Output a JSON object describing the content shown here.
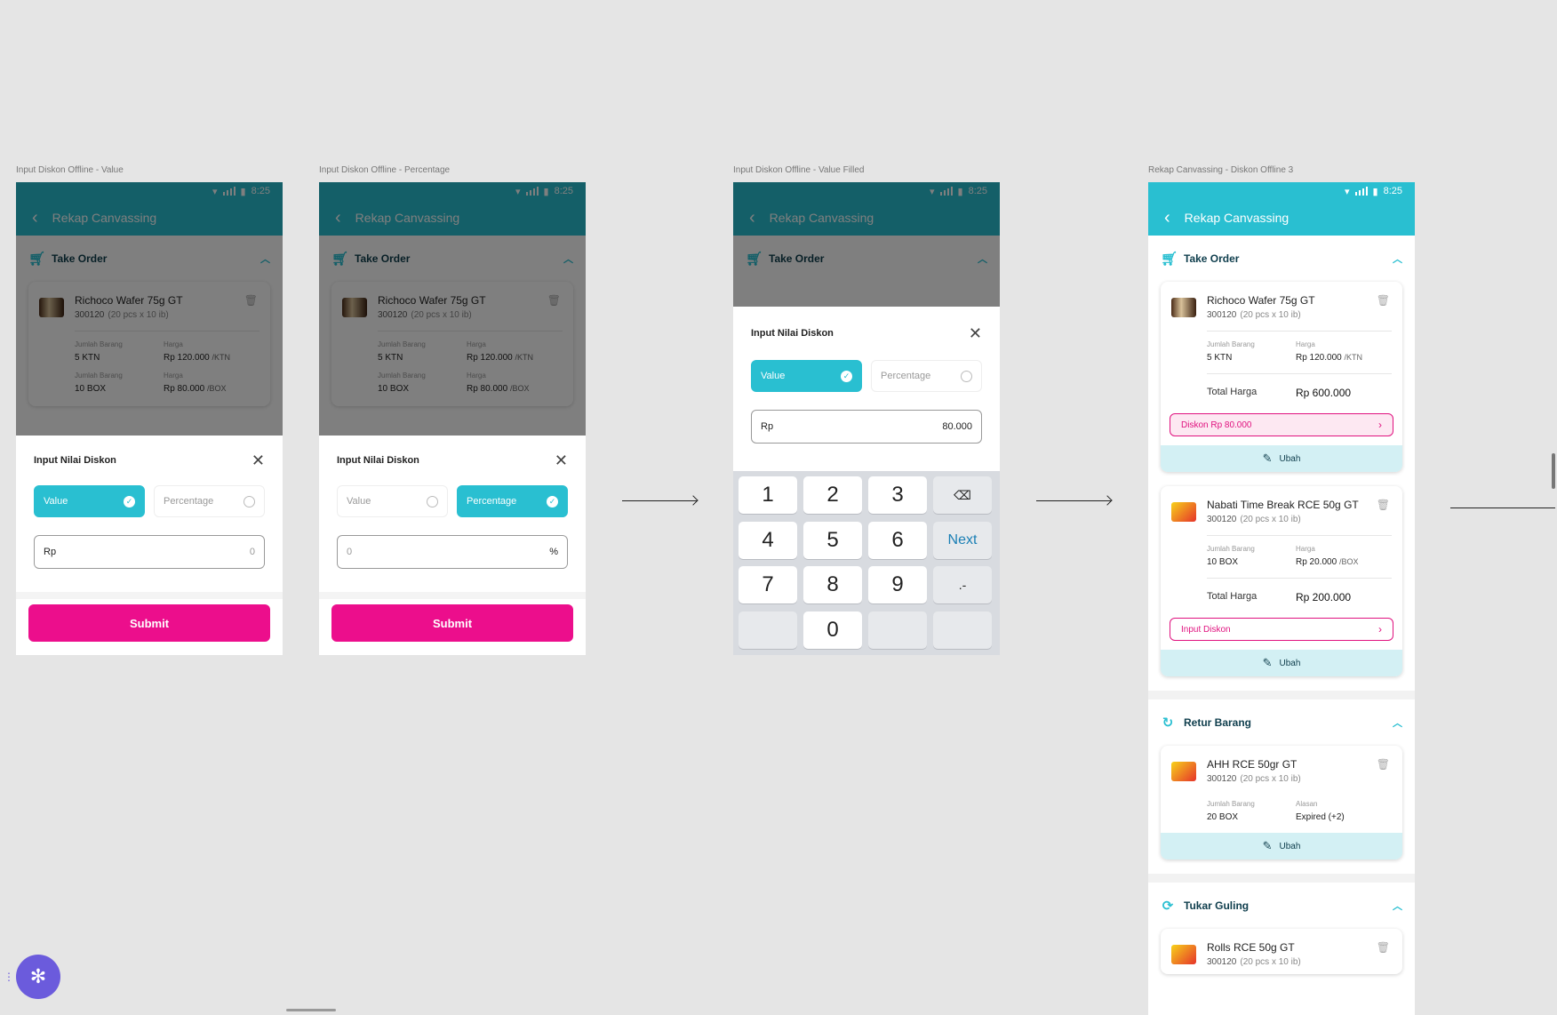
{
  "frames": {
    "f1": {
      "label": "Input Diskon Offline - Value"
    },
    "f2": {
      "label": "Input Diskon Offline - Percentage"
    },
    "f3": {
      "label": "Input Diskon Offline - Value Filled"
    },
    "f4": {
      "label": "Rekap Canvassing - Diskon Offline 3"
    }
  },
  "status": {
    "time": "8:25"
  },
  "appbar": {
    "title": "Rekap Canvassing",
    "back_icon": "arrow-left-icon"
  },
  "sections": {
    "take_order": "Take Order",
    "retur": "Retur Barang",
    "tukar": "Tukar Guling"
  },
  "products": {
    "p1": {
      "name": "Richoco Wafer 75g GT",
      "code": "300120",
      "pack": "(20 pcs x 10 ib)",
      "qty_label": "Jumlah Barang",
      "qty1": "5 KTN",
      "qty2": "10 BOX",
      "price_label": "Harga",
      "price1": "Rp 120.000",
      "unit1": "/KTN",
      "price2": "Rp 80.000",
      "unit2": "/BOX",
      "total_label": "Total Harga",
      "total": "Rp 600.000",
      "discount": "Diskon Rp 80.000"
    },
    "p2": {
      "name": "Nabati Time Break RCE 50g GT",
      "code": "300120",
      "pack": "(20 pcs x 10 ib)",
      "qty_label": "Jumlah Barang",
      "qty1": "10 BOX",
      "price_label": "Harga",
      "price1": "Rp 20.000",
      "unit1": "/BOX",
      "total_label": "Total Harga",
      "total": "Rp 200.000",
      "discount": "Input Diskon"
    },
    "p3": {
      "name": "AHH RCE 50gr GT",
      "code": "300120",
      "pack": "(20 pcs x 10 ib)",
      "qty_label": "Jumlah Barang",
      "qty1": "20 BOX",
      "reason_label": "Alasan",
      "reason": "Expired (+2)"
    },
    "p4": {
      "name": "Rolls RCE 50g GT",
      "code": "300120",
      "pack": "(20 pcs x 10 ib)"
    }
  },
  "ubah_label": "Ubah",
  "sheet": {
    "title": "Input Nilai Diskon",
    "value_label": "Value",
    "percentage_label": "Percentage",
    "rp_prefix": "Rp",
    "value_zero": "0",
    "percent_placeholder": "0",
    "percent_suffix": "%",
    "filled_value": "80.000",
    "submit_label": "Submit"
  },
  "keypad": {
    "k1": "1",
    "k2": "2",
    "k3": "3",
    "k4": "4",
    "k5": "5",
    "k6": "6",
    "k7": "7",
    "k8": "8",
    "k9": "9",
    "k0": "0",
    "next": "Next",
    "dotdash": ".-",
    "backspace_icon": "backspace-icon"
  },
  "colors": {
    "teal": "#29bfd1",
    "pink": "#ec0e8c",
    "fab": "#6b5bdc"
  }
}
